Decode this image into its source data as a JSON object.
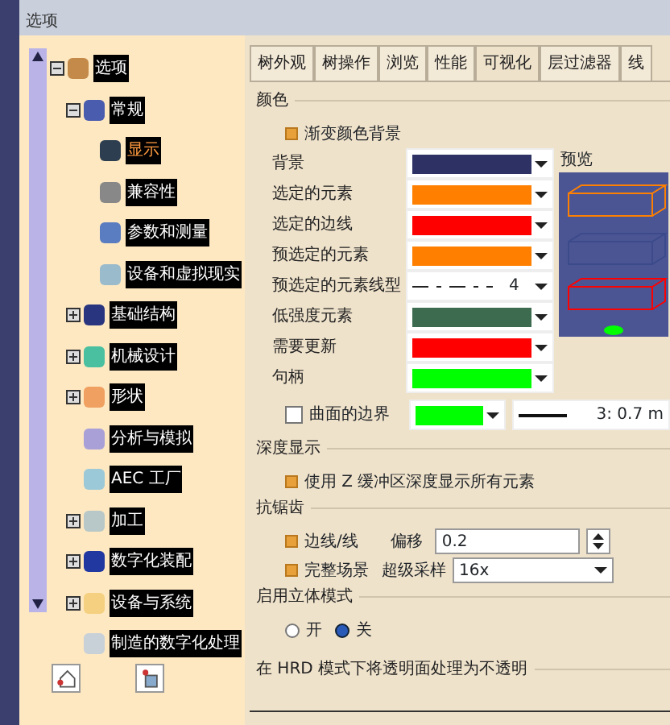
{
  "window": {
    "title": "选项"
  },
  "tree": [
    {
      "label": "选项",
      "selected": false,
      "expanded": true,
      "children": [
        {
          "label": "常规",
          "selected": false,
          "expanded": true,
          "children": [
            {
              "label": "显示",
              "selected": true
            },
            {
              "label": "兼容性",
              "selected": false
            },
            {
              "label": "参数和测量",
              "selected": false
            },
            {
              "label": "设备和虚拟现实",
              "selected": false
            }
          ]
        },
        {
          "label": "基础结构",
          "selected": false,
          "expanded": false
        },
        {
          "label": "机械设计",
          "selected": false,
          "expanded": false
        },
        {
          "label": "形状",
          "selected": false,
          "expanded": false
        },
        {
          "label": "分析与模拟",
          "selected": false
        },
        {
          "label": "AEC 工厂",
          "selected": false
        },
        {
          "label": "加工",
          "selected": false,
          "expanded": false
        },
        {
          "label": "数字化装配",
          "selected": false,
          "expanded": false
        },
        {
          "label": "设备与系统",
          "selected": false,
          "expanded": false
        },
        {
          "label": "制造的数字化处理",
          "selected": false
        }
      ]
    }
  ],
  "tabs": [
    {
      "label": "树外观",
      "selected": false
    },
    {
      "label": "树操作",
      "selected": false
    },
    {
      "label": "浏览",
      "selected": false
    },
    {
      "label": "性能",
      "selected": false
    },
    {
      "label": "可视化",
      "selected": true
    },
    {
      "label": "层过滤器",
      "selected": false
    },
    {
      "label": "线",
      "selected": false
    }
  ],
  "colors": {
    "title": "颜色",
    "gradient": {
      "label": "渐变颜色背景",
      "checked": true
    },
    "rows": [
      {
        "kind": "color",
        "label": "背景",
        "color": "#2e3163"
      },
      {
        "kind": "color",
        "label": "选定的元素",
        "color": "#ff8000"
      },
      {
        "kind": "color",
        "label": "选定的边线",
        "color": "#ff0000"
      },
      {
        "kind": "color",
        "label": "预选定的元素",
        "color": "#ff8000"
      },
      {
        "kind": "linetype",
        "label": "预选定的元素线型",
        "value": "4"
      },
      {
        "kind": "color",
        "label": "低强度元素",
        "color": "#3d6b50"
      },
      {
        "kind": "color",
        "label": "需要更新",
        "color": "#ff0000"
      },
      {
        "kind": "color",
        "label": "句柄",
        "color": "#00ff00"
      }
    ],
    "preview_label": "预览",
    "surface_boundary": {
      "label": "曲面的边界",
      "checked": false,
      "color": "#00ff00",
      "line_width": "3: 0.7 m"
    }
  },
  "depth": {
    "title": "深度显示",
    "option": {
      "label": "使用 Z 缓冲区深度显示所有元素",
      "checked": true
    }
  },
  "antialias": {
    "title": "抗锯齿",
    "edges": {
      "label": "边线/线",
      "checked": true,
      "offset_label": "偏移",
      "offset_value": "0.2"
    },
    "scene": {
      "label": "完整场景",
      "checked": true,
      "sampling_label": "超级采样",
      "sampling_value": "16x"
    }
  },
  "stereo": {
    "title": "启用立体模式",
    "options": [
      {
        "label": "开",
        "selected": false
      },
      {
        "label": "关",
        "selected": true
      }
    ]
  },
  "hrd": {
    "title": "在 HRD 模式下将透明面处理为不透明"
  }
}
